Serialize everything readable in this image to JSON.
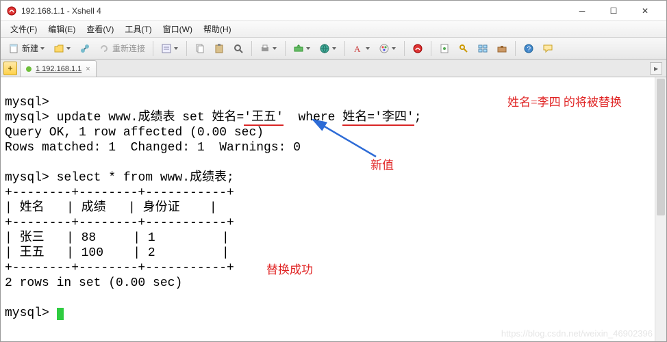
{
  "window": {
    "title": "192.168.1.1 - Xshell 4"
  },
  "menu": {
    "file": "文件(F)",
    "edit": "编辑(E)",
    "view": "查看(V)",
    "tool": "工具(T)",
    "window": "窗口(W)",
    "help": "帮助(H)"
  },
  "toolbar": {
    "new_btn": "新建",
    "reconnect": "重新连接"
  },
  "tab": {
    "label": "1 192.168.1.1"
  },
  "annotations": {
    "replace_note": "姓名=李四 的将被替换",
    "new_value": "新值",
    "success": "替换成功"
  },
  "watermark": "https://blog.csdn.net/weixin_46902396",
  "terminal": {
    "prompt": "mysql>",
    "update_sql": "update www.成绩表 set 姓名=",
    "new_val": "'王五'",
    "where_kw": "  where ",
    "where_cond": "姓名='李四'",
    "update_end": ";",
    "query_ok": "Query OK, 1 row affected (0.00 sec)",
    "rows_matched": "Rows matched: 1  Changed: 1  Warnings: 0",
    "select_sql": "select * from www.成绩表;",
    "border": "+--------+--------+-----------+",
    "header": "| 姓名   | 成绩   | 身份证    |",
    "row1": "| 张三   | 88     | 1         |",
    "row2": "| 王五   | 100    | 2         |",
    "rows_in_set": "2 rows in set (0.00 sec)"
  },
  "chart_data": {
    "type": "table",
    "title": "www.成绩表",
    "columns": [
      "姓名",
      "成绩",
      "身份证"
    ],
    "rows": [
      {
        "姓名": "张三",
        "成绩": 88,
        "身份证": 1
      },
      {
        "姓名": "王五",
        "成绩": 100,
        "身份证": 2
      }
    ],
    "row_count": 2,
    "elapsed_sec": 0.0,
    "update": {
      "column": "姓名",
      "new_value": "王五",
      "where_column": "姓名",
      "where_value": "李四",
      "affected": 1,
      "matched": 1,
      "changed": 1,
      "warnings": 0,
      "elapsed_sec": 0.0
    }
  }
}
